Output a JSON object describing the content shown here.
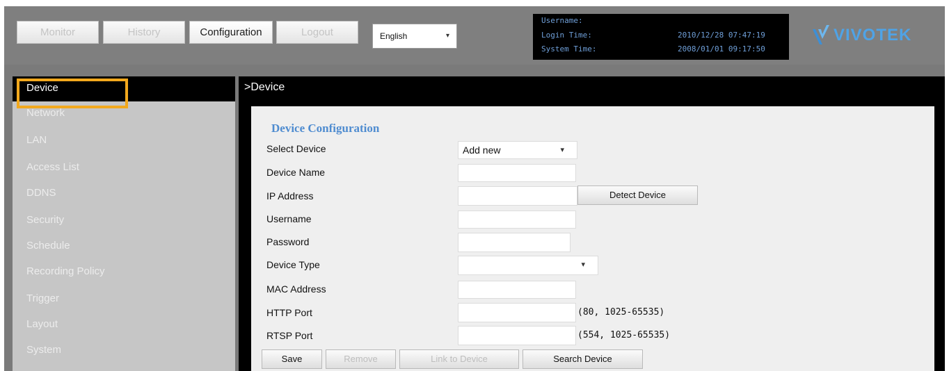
{
  "nav": {
    "monitor": "Monitor",
    "history": "History",
    "configuration": "Configuration",
    "logout": "Logout",
    "language": "English"
  },
  "info": {
    "username_label": "Username:",
    "login_time_label": "Login Time:",
    "login_time_value": "2010/12/28 07:47:19",
    "system_time_label": "System Time:",
    "system_time_value": "2008/01/01 09:17:50"
  },
  "logo": {
    "text": "VIVOTEK"
  },
  "sidebar": {
    "items": [
      {
        "label": "Device"
      },
      {
        "label": "Network"
      },
      {
        "label": "LAN"
      },
      {
        "label": "Access List"
      },
      {
        "label": "DDNS"
      },
      {
        "label": "Security"
      },
      {
        "label": "Schedule"
      },
      {
        "label": "Recording Policy"
      },
      {
        "label": "Trigger"
      },
      {
        "label": "Layout"
      },
      {
        "label": "System"
      }
    ]
  },
  "main": {
    "title": ">Device",
    "section_title": "Device Configuration",
    "fields": {
      "select_device": {
        "label": "Select Device",
        "value": "Add new"
      },
      "device_name": {
        "label": "Device Name",
        "value": ""
      },
      "ip_address": {
        "label": "IP Address",
        "value": ""
      },
      "username": {
        "label": "Username",
        "value": ""
      },
      "password": {
        "label": "Password",
        "value": ""
      },
      "device_type": {
        "label": "Device Type",
        "value": ""
      },
      "mac_address": {
        "label": "MAC Address",
        "value": ""
      },
      "http_port": {
        "label": "HTTP Port",
        "value": "",
        "hint": "(80, 1025-65535)"
      },
      "rtsp_port": {
        "label": "RTSP Port",
        "value": "",
        "hint": "(554, 1025-65535)"
      }
    },
    "detect_button": "Detect Device",
    "buttons": {
      "save": "Save",
      "remove": "Remove",
      "link": "Link to Device",
      "search": "Search Device"
    }
  },
  "colors": {
    "highlight": "#f2a81d",
    "accent_blue": "#4f8cd0",
    "info_text": "#6f9fd8"
  }
}
